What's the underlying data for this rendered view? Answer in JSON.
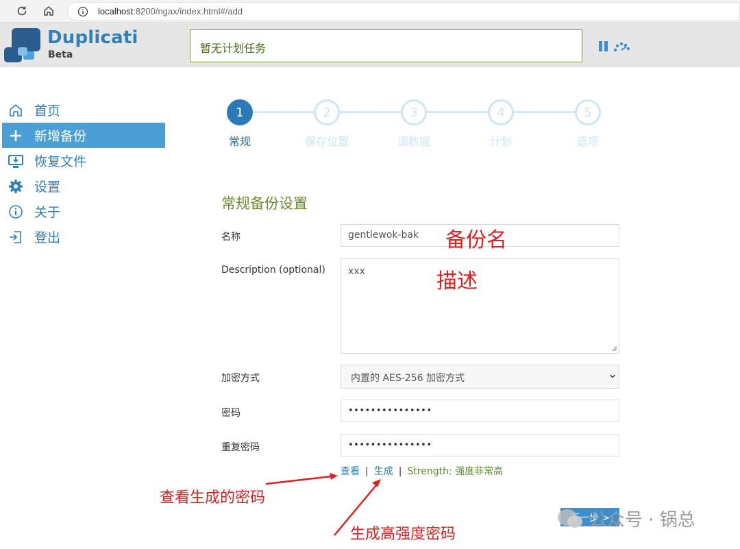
{
  "browser": {
    "url_host": "localhost",
    "url_rest": ":8200/ngax/index.html#/add"
  },
  "header": {
    "brand_name": "Duplicati",
    "brand_sub": "Beta",
    "schedule_status": "暂无计划任务"
  },
  "sidebar": {
    "items": [
      {
        "label": "首页",
        "icon": "home-icon"
      },
      {
        "label": "新增备份",
        "icon": "plus-icon"
      },
      {
        "label": "恢复文件",
        "icon": "restore-icon"
      },
      {
        "label": "设置",
        "icon": "gear-icon"
      },
      {
        "label": "关于",
        "icon": "info-icon"
      },
      {
        "label": "登出",
        "icon": "logout-icon"
      }
    ],
    "active_index": 1
  },
  "steps": [
    {
      "number": "1",
      "label": "常规"
    },
    {
      "number": "2",
      "label": "保存位置"
    },
    {
      "number": "3",
      "label": "源数据"
    },
    {
      "number": "4",
      "label": "计划"
    },
    {
      "number": "5",
      "label": "选项"
    }
  ],
  "form": {
    "section_title": "常规备份设置",
    "name_label": "名称",
    "name_value": "gentlewok-bak",
    "description_label": "Description (optional)",
    "description_value": "xxx",
    "encryption_label": "加密方式",
    "encryption_value": "内置的 AES-256 加密方式",
    "password_label": "密码",
    "password_value": "•••••••••••••••",
    "repeat_password_label": "重复密码",
    "repeat_password_value": "•••••••••••••••",
    "show_link": "查看",
    "generate_link": "生成",
    "strength_text": "Strength: 强度非常高",
    "next_button": "下一步 >"
  },
  "annotations": {
    "name_note": "备份名",
    "description_note": "描述",
    "show_password_note": "查看生成的密码",
    "generate_note": "生成高强度密码"
  },
  "watermark": "公众号 · 锅总",
  "colors": {
    "brand_blue": "#2f7fb8",
    "active_blue": "#4a9fd6",
    "step_active": "#2a7ab8",
    "section_green": "#6b8a2e",
    "annotation_red": "#e02020"
  }
}
